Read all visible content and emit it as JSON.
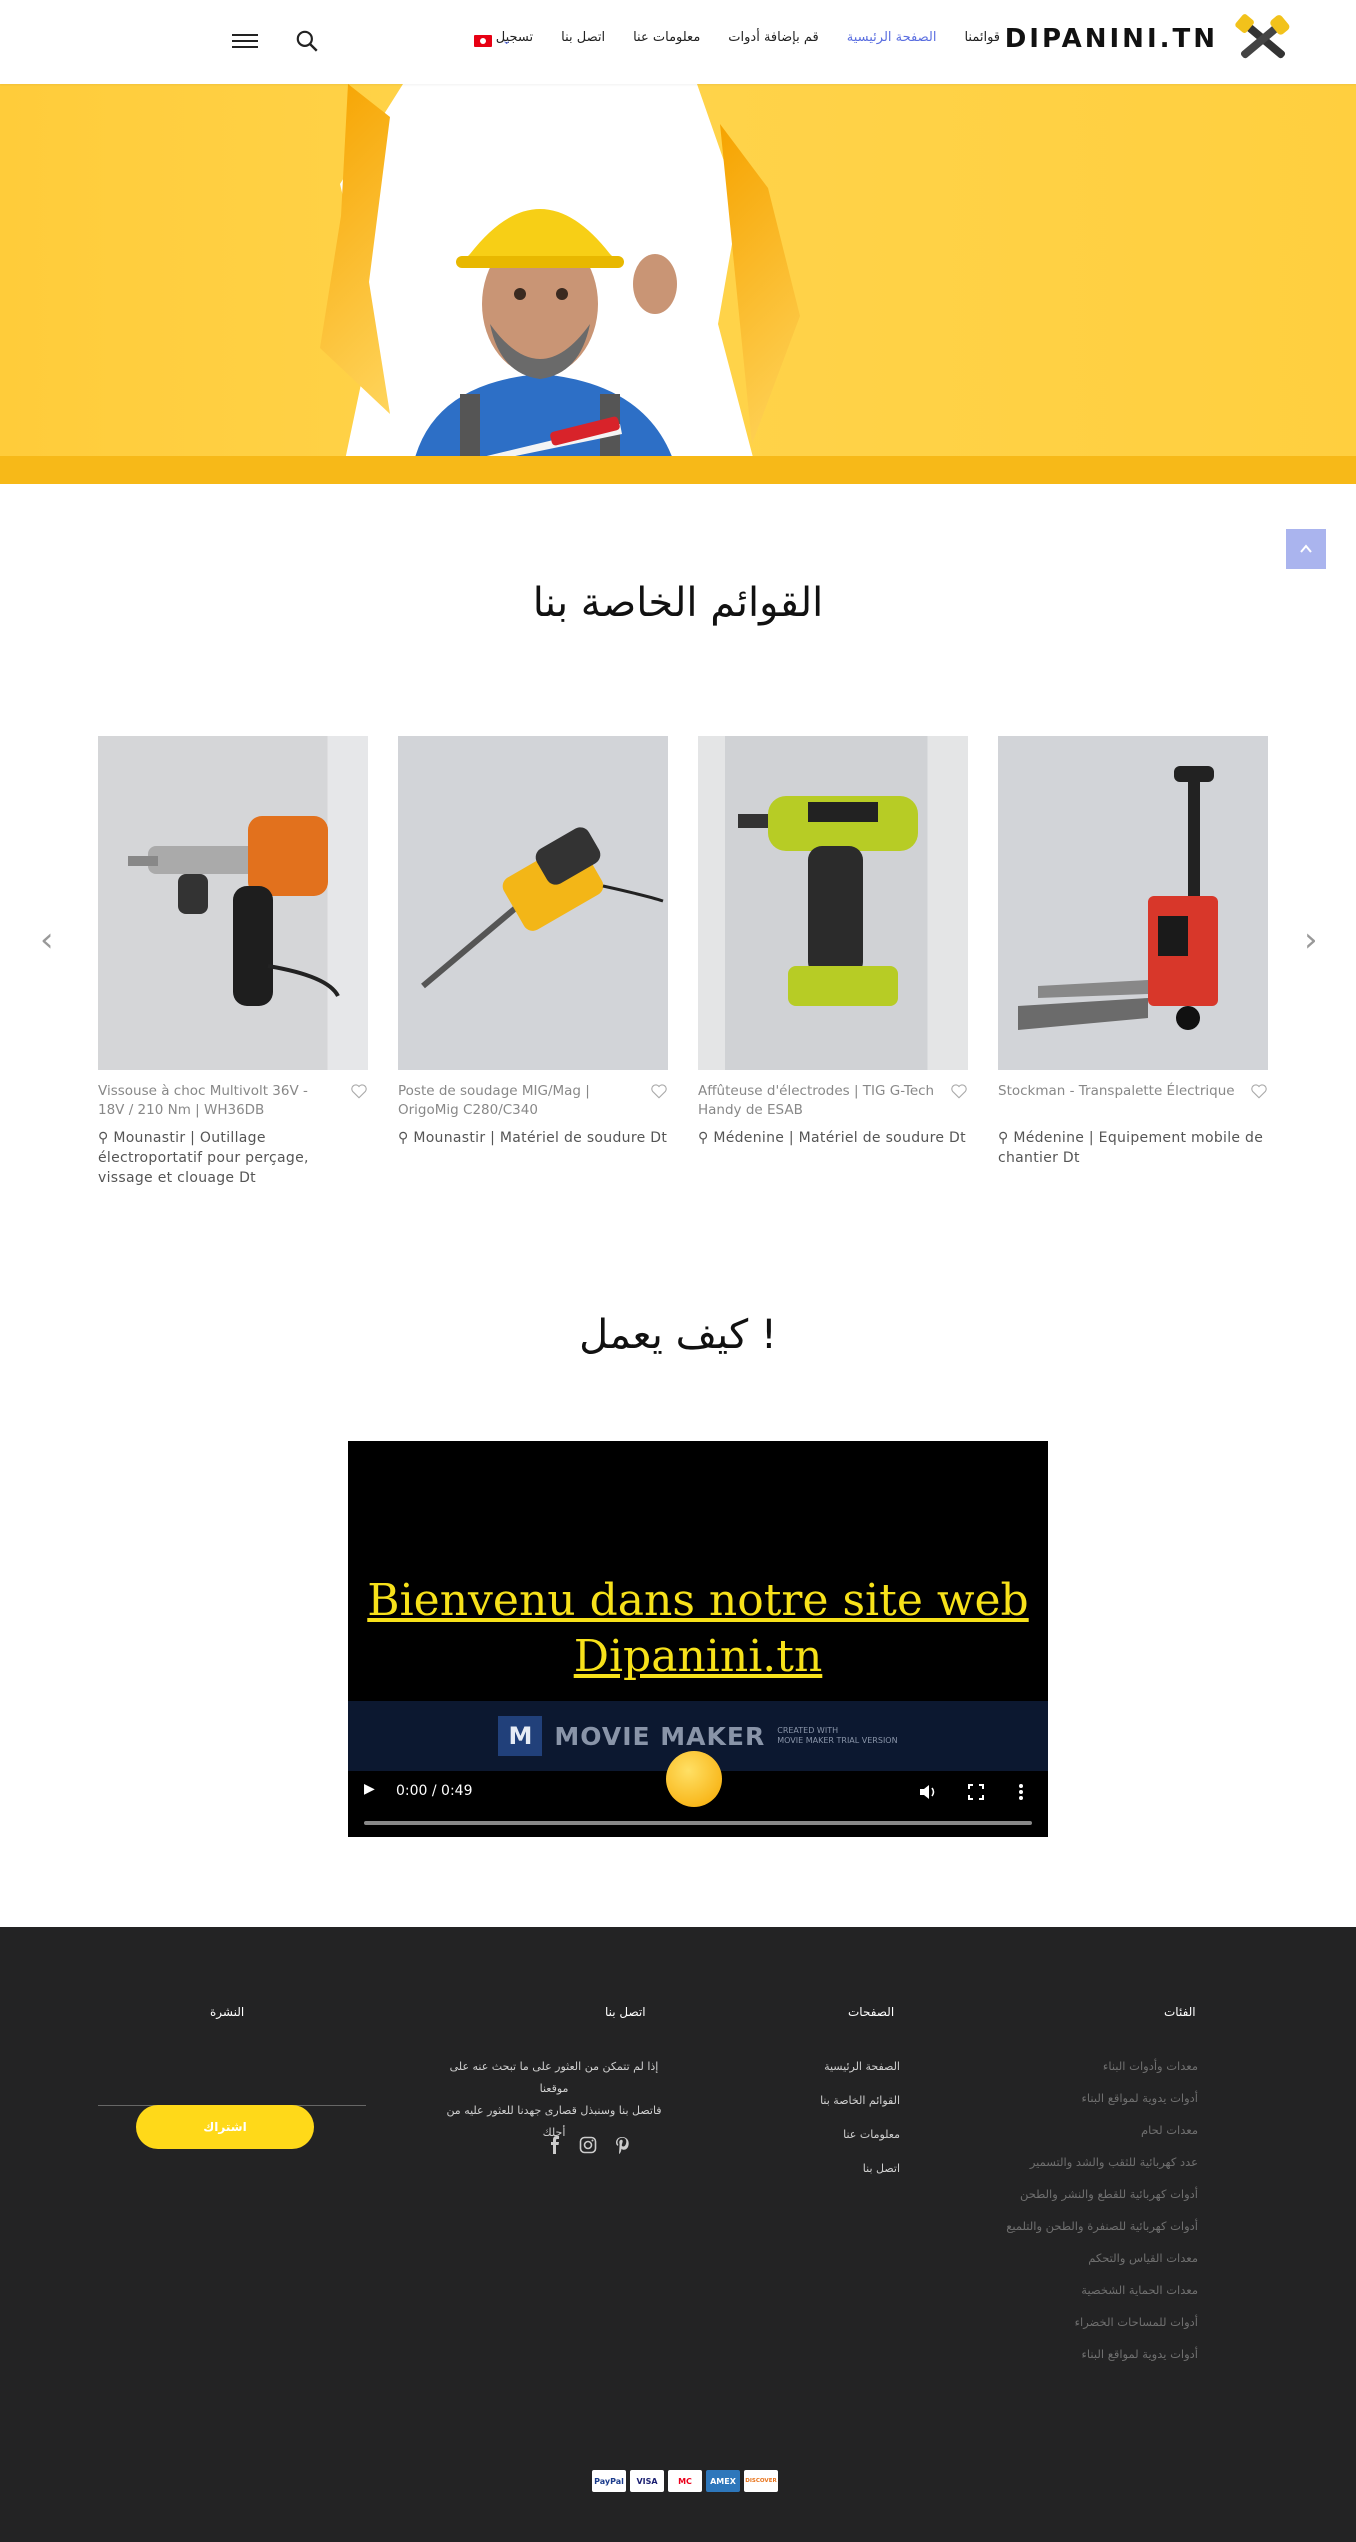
{
  "header": {
    "logo_text": "DIPANINI.TN",
    "nav": [
      "قوائمنا",
      "الصفحة الرئيسية",
      "قم بإضافة أدوات",
      "معلومات عنا",
      "اتصل بنا",
      "تسجيل"
    ],
    "nav_active_index": 1
  },
  "sections": {
    "listings_title": "القوائم الخاصة بنا",
    "how_title": "كيف يعمل !"
  },
  "cards": [
    {
      "title": "Vissouse à choc Multivolt 36V - 18V / 210 Nm | WH36DB",
      "location": "Mounastir | Outillage électroportatif pour perçage, vissage et clouage Dt"
    },
    {
      "title": "Poste de soudage MIG/Mag | OrigoMig C280/C340",
      "location": "Mounastir | Matériel de soudure Dt"
    },
    {
      "title": "Affûteuse d'électrodes | TIG G-Tech Handy de ESAB",
      "location": "Médenine | Matériel de soudure Dt"
    },
    {
      "title": "Stockman - Transpalette Électrique",
      "location": "Médenine | Equipement mobile de chantier Dt"
    }
  ],
  "video": {
    "line1": "Bienvenu  dans notre site web",
    "line2": "Dipanini.tn",
    "watermark_title": "MOVIE MAKER",
    "watermark_sub1": "CREATED WITH",
    "watermark_sub2": "MOVIE MAKER TRIAL VERSION",
    "time": "0:00 / 0:49"
  },
  "footer": {
    "categories_title": "الفئات",
    "categories": [
      "معدات وأدوات البناء",
      "أدوات يدوية لمواقع البناء",
      "معدات لحام",
      "عدد كهربائية للثقب والشد والتسمير",
      "أدوات كهربائية للقطع والنشر والطحن",
      "أدوات كهربائية للصنفرة والطحن والتلميع",
      "معدات القياس والتحكم",
      "معدات الحماية الشخصية",
      "أدوات للمساحات الخضراء",
      "أدوات يدوية لمواقع البناء"
    ],
    "pages_title": "الصفحات",
    "pages": [
      "الصفحة الرئيسية",
      "القوائم الخاصة بنا",
      "معلومات عنا",
      "اتصل بنا"
    ],
    "contact_title": "اتصل بنا",
    "contact_line1": "إذا لم تتمكن من العثور على ما تبحث عنه على موقعنا",
    "contact_line2": "فاتصل بنا وسنبذل قصارى جهدنا للعثور عليه من أجلك",
    "newsletter_title": "النشرة",
    "subscribe": "اشتراك",
    "payments": [
      "PayPal",
      "VISA",
      "MC",
      "AMEX",
      "DISCOVER"
    ]
  }
}
